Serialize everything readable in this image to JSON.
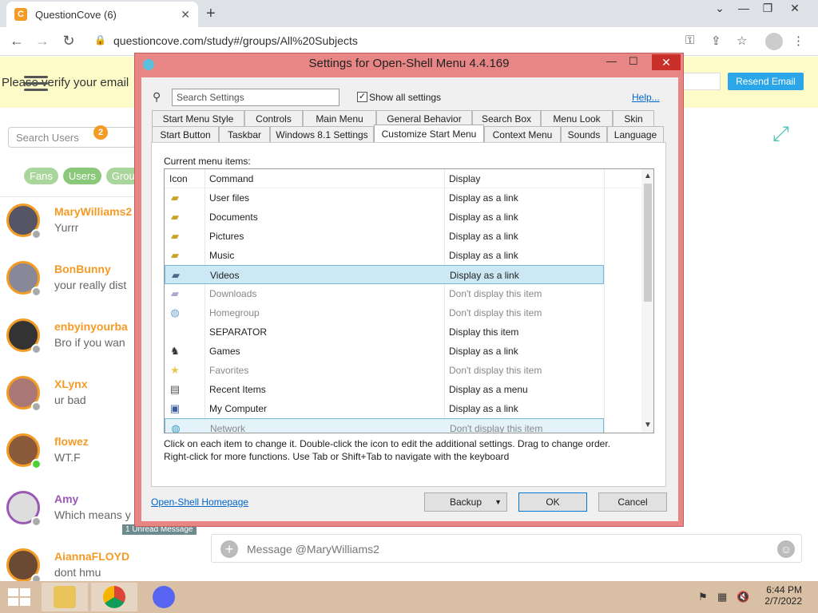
{
  "browser": {
    "tab_title": "QuestionCove (6)",
    "url": "questioncove.com/study#/groups/All%20Subjects"
  },
  "page": {
    "banner_text": "Please verify your email",
    "resend_label": "Resend Email",
    "search_users_placeholder": "Search Users",
    "notification_count": "2",
    "filter_pills": [
      "Fans",
      "Users",
      "Grou"
    ],
    "users": [
      {
        "name": "MaryWilliams2",
        "message": "Yurrr",
        "status": "offline"
      },
      {
        "name": "BonBunny",
        "message": "your really dist",
        "status": "offline"
      },
      {
        "name": "enbyinyourba",
        "message": "Bro if you wan",
        "status": "offline"
      },
      {
        "name": "XLynx",
        "message": "ur bad",
        "status": "offline"
      },
      {
        "name": "flowez",
        "message": "WT.F",
        "status": "online"
      },
      {
        "name": "Amy",
        "message": "Which means y",
        "status": "offline"
      },
      {
        "name": "AiannaFLOYD",
        "message": "dont hmu",
        "status": "offline"
      }
    ],
    "unread_badge": "1 Unread Message",
    "compose_placeholder": "Message @MaryWilliams2"
  },
  "dialog": {
    "title": "Settings for Open-Shell Menu 4.4.169",
    "search_placeholder": "Search Settings",
    "show_all_label": "Show all settings",
    "show_all_checked": true,
    "help_label": "Help...",
    "tabs_row1": [
      "Start Menu Style",
      "Controls",
      "Main Menu",
      "General Behavior",
      "Search Box",
      "Menu Look",
      "Skin"
    ],
    "tabs_row2": [
      "Start Button",
      "Taskbar",
      "Windows 8.1 Settings",
      "Customize Start Menu",
      "Context Menu",
      "Sounds",
      "Language"
    ],
    "selected_tab": "Customize Start Menu",
    "current_items_label": "Current menu items:",
    "columns": {
      "icon": "Icon",
      "command": "Command",
      "display": "Display"
    },
    "items": [
      {
        "icon": "user-folder-icon",
        "command": "User files",
        "display": "Display as a link",
        "dim": false
      },
      {
        "icon": "documents-icon",
        "command": "Documents",
        "display": "Display as a link",
        "dim": false
      },
      {
        "icon": "pictures-icon",
        "command": "Pictures",
        "display": "Display as a link",
        "dim": false
      },
      {
        "icon": "music-icon",
        "command": "Music",
        "display": "Display as a link",
        "dim": false
      },
      {
        "icon": "videos-icon",
        "command": "Videos",
        "display": "Display as a link",
        "dim": false,
        "selected": true
      },
      {
        "icon": "downloads-icon",
        "command": "Downloads",
        "display": "Don't display this item",
        "dim": true
      },
      {
        "icon": "homegroup-icon",
        "command": "Homegroup",
        "display": "Don't display this item",
        "dim": true
      },
      {
        "icon": "",
        "command": "SEPARATOR",
        "display": "Display this item",
        "dim": false
      },
      {
        "icon": "games-icon",
        "command": "Games",
        "display": "Display as a link",
        "dim": false
      },
      {
        "icon": "favorites-icon",
        "command": "Favorites",
        "display": "Don't display this item",
        "dim": true
      },
      {
        "icon": "recent-items-icon",
        "command": "Recent Items",
        "display": "Display as a menu",
        "dim": false
      },
      {
        "icon": "computer-icon",
        "command": "My Computer",
        "display": "Display as a link",
        "dim": false
      },
      {
        "icon": "network-icon",
        "command": "Network",
        "display": "Don't display this item",
        "dim": true
      }
    ],
    "instructions_line1": "Click on each item to change it. Double-click the icon to edit the additional settings. Drag to change order.",
    "instructions_line2": "Right-click for more functions. Use Tab or Shift+Tab to navigate with the keyboard",
    "homepage_link": "Open-Shell Homepage",
    "backup_label": "Backup",
    "ok_label": "OK",
    "cancel_label": "Cancel"
  },
  "taskbar": {
    "time": "6:44 PM",
    "date": "2/7/2022"
  }
}
